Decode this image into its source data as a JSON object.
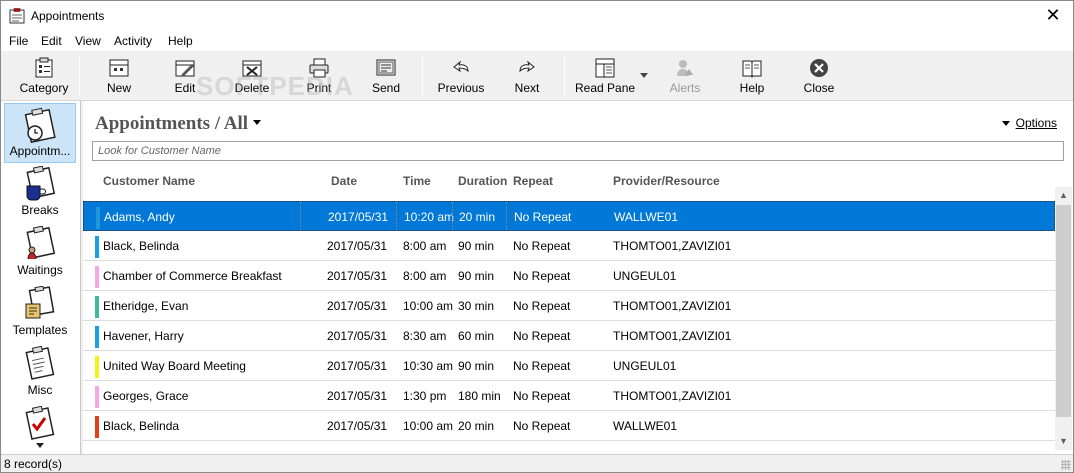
{
  "window": {
    "title": "Appointments"
  },
  "menu": [
    "File",
    "Edit",
    "View",
    "Activity",
    "Help"
  ],
  "toolbar": {
    "category": "Category",
    "new": "New",
    "edit": "Edit",
    "delete": "Delete",
    "print": "Print",
    "send": "Send",
    "previous": "Previous",
    "next": "Next",
    "read_pane": "Read Pane",
    "alerts": "Alerts",
    "help": "Help",
    "close": "Close"
  },
  "watermark": "SOFTPEDIA",
  "sidebar": [
    {
      "label": "Appointm...",
      "icon": "appointments-clipboard-icon",
      "active": true
    },
    {
      "label": "Breaks",
      "icon": "breaks-coffee-icon"
    },
    {
      "label": "Waitings",
      "icon": "waitings-clipboard-icon"
    },
    {
      "label": "Templates",
      "icon": "templates-clipboard-icon"
    },
    {
      "label": "Misc",
      "icon": "misc-clipboard-icon"
    },
    {
      "label": "",
      "icon": "checklist-clipboard-icon"
    }
  ],
  "main": {
    "breadcrumb": "Appointments / All",
    "options_label": "Options",
    "search_placeholder": "Look for Customer Name"
  },
  "table": {
    "columns": [
      "Customer Name",
      "Date",
      "Time",
      "Duration",
      "Repeat",
      "Provider/Resource"
    ],
    "rows": [
      {
        "color": "#2196d9",
        "name": "Adams, Andy",
        "date": "2017/05/31",
        "time": "10:20 am",
        "duration": "20 min",
        "repeat": "No Repeat",
        "provider": "WALLWE01",
        "selected": true
      },
      {
        "color": "#1aa0e0",
        "name": "Black, Belinda",
        "date": "2017/05/31",
        "time": "8:00 am",
        "duration": "90 min",
        "repeat": "No Repeat",
        "provider": "THOMTO01,ZAVIZI01"
      },
      {
        "color": "#f2a7e6",
        "name": "Chamber of Commerce Breakfast",
        "date": "2017/05/31",
        "time": "8:00 am",
        "duration": "90 min",
        "repeat": "No Repeat",
        "provider": "UNGEUL01"
      },
      {
        "color": "#3fb9a0",
        "name": "Etheridge, Evan",
        "date": "2017/05/31",
        "time": "10:00 am",
        "duration": "30 min",
        "repeat": "No Repeat",
        "provider": "THOMTO01,ZAVIZI01"
      },
      {
        "color": "#1aa0e0",
        "name": "Havener, Harry",
        "date": "2017/05/31",
        "time": "8:30 am",
        "duration": "60 min",
        "repeat": "No Repeat",
        "provider": "THOMTO01,ZAVIZI01"
      },
      {
        "color": "#f5f21a",
        "name": "United Way Board Meeting",
        "date": "2017/05/31",
        "time": "10:30 am",
        "duration": "90 min",
        "repeat": "No Repeat",
        "provider": "UNGEUL01"
      },
      {
        "color": "#f2a7e6",
        "name": "Georges, Grace",
        "date": "2017/05/31",
        "time": "1:30 pm",
        "duration": "180 min",
        "repeat": "No Repeat",
        "provider": "THOMTO01,ZAVIZI01"
      },
      {
        "color": "#e0401a",
        "name": "Black, Belinda",
        "date": "2017/05/31",
        "time": "10:00 am",
        "duration": "20 min",
        "repeat": "No Repeat",
        "provider": "WALLWE01"
      }
    ]
  },
  "status": {
    "records": "8 record(s)"
  }
}
